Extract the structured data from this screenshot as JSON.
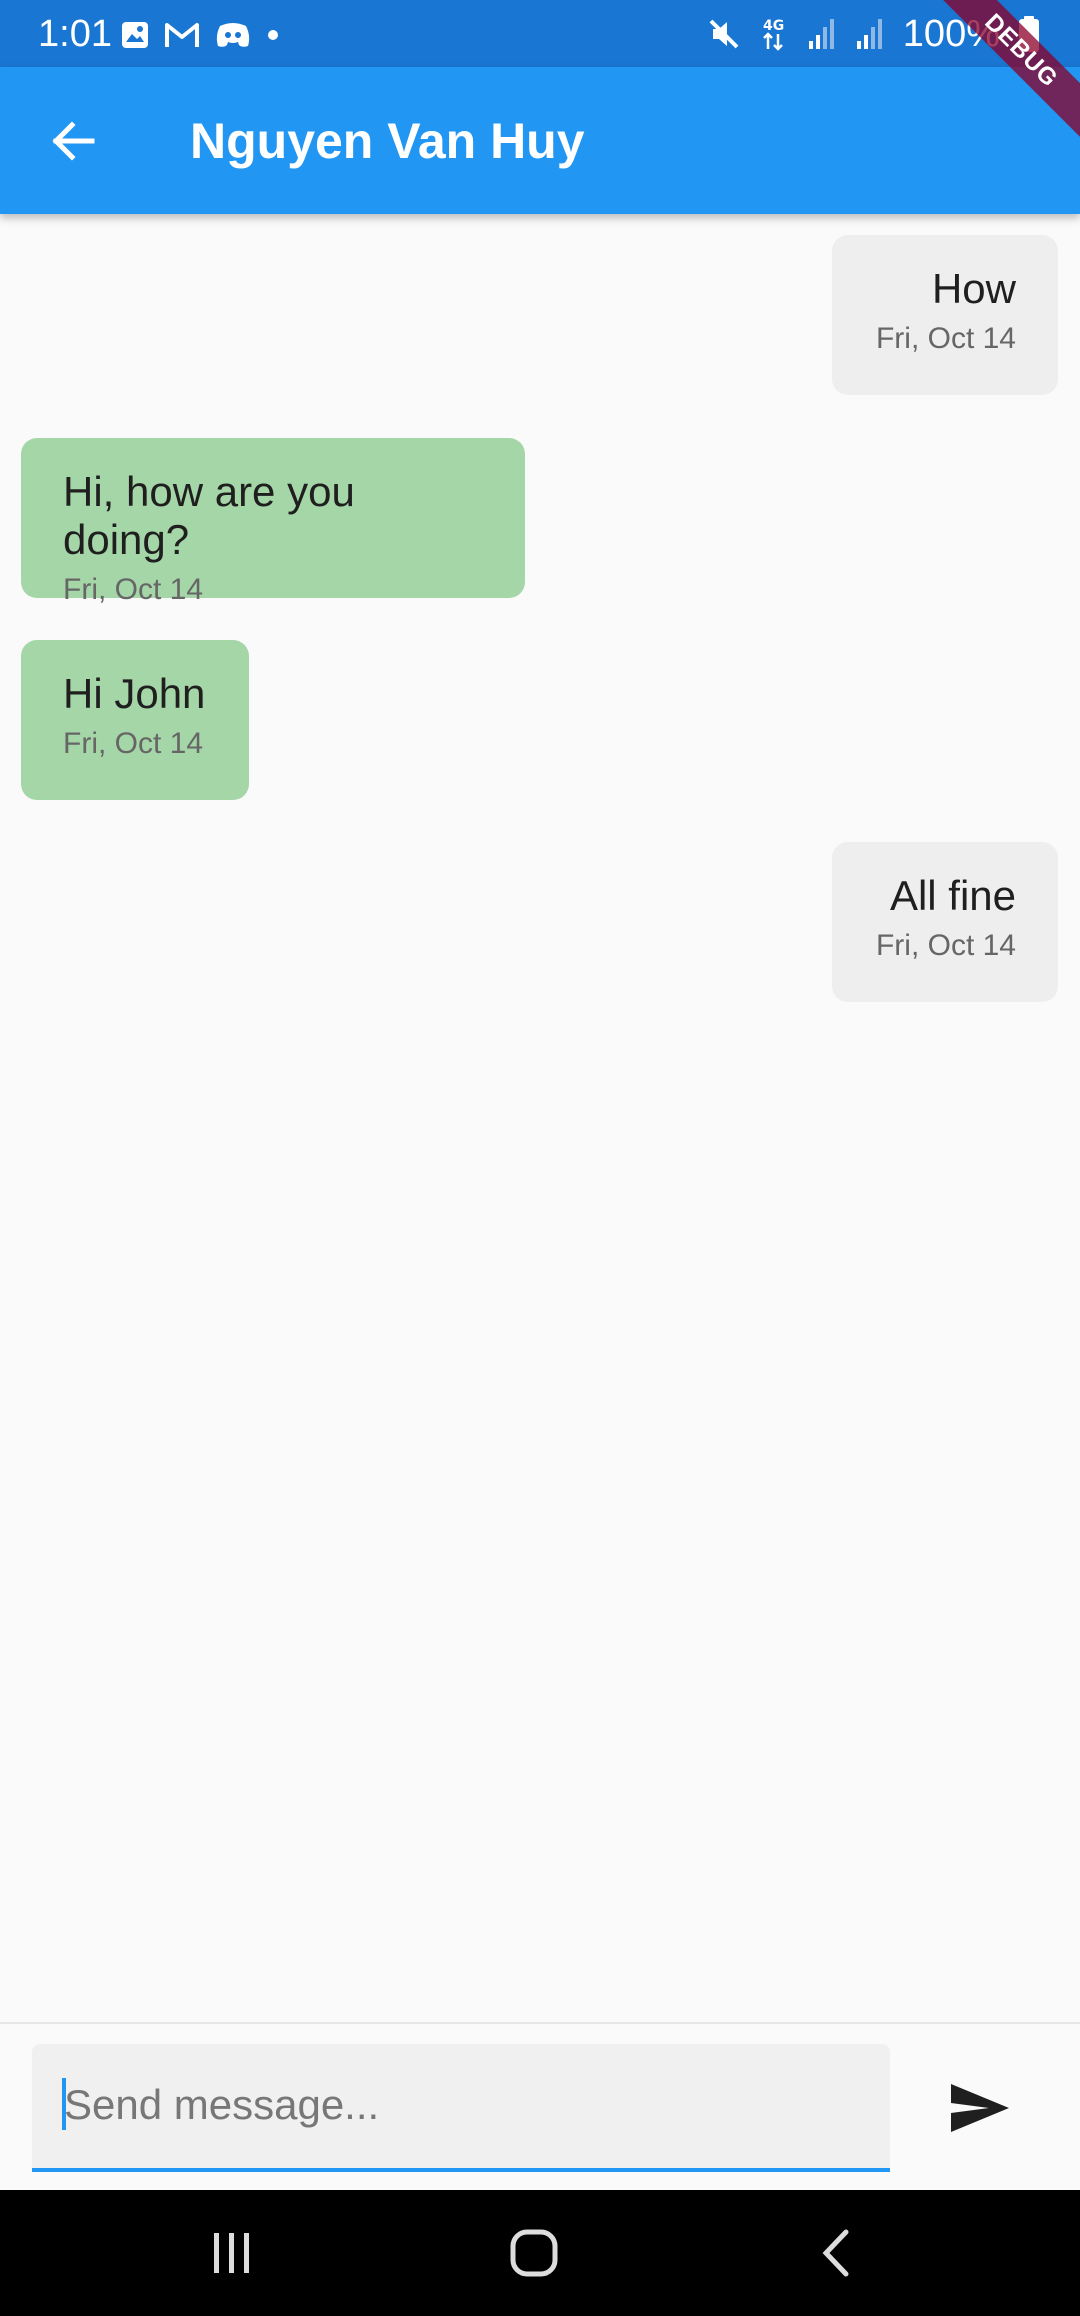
{
  "status_bar": {
    "time": "1:01",
    "battery": "100%",
    "left_icons": [
      "image-icon",
      "gmail-icon",
      "discord-icon",
      "dot-icon"
    ],
    "right_icons": [
      "mute-icon",
      "4g-icon",
      "signal-icon",
      "signal-icon",
      "battery-icon"
    ],
    "background_color": "#1976d2"
  },
  "debug_banner": "DEBUG",
  "app_bar": {
    "title": "Nguyen Van Huy",
    "back_icon": "arrow-back-icon",
    "background_color": "#2196f3"
  },
  "messages": [
    {
      "text": "How",
      "date": "Fri, Oct 14",
      "direction": "sent"
    },
    {
      "text": "Hi, how are you doing?",
      "date": "Fri, Oct 14",
      "direction": "received"
    },
    {
      "text": "Hi John",
      "date": "Fri, Oct 14",
      "direction": "received"
    },
    {
      "text": "All fine",
      "date": "Fri, Oct 14",
      "direction": "sent"
    }
  ],
  "colors": {
    "sent_bubble": "#eeeeee",
    "received_bubble": "#a5d6a7",
    "accent": "#2196f3"
  },
  "composer": {
    "placeholder": "Send message...",
    "value": "",
    "send_icon": "send-icon"
  },
  "nav_bar": {
    "buttons": [
      "recent-apps-icon",
      "home-icon",
      "back-icon"
    ]
  }
}
